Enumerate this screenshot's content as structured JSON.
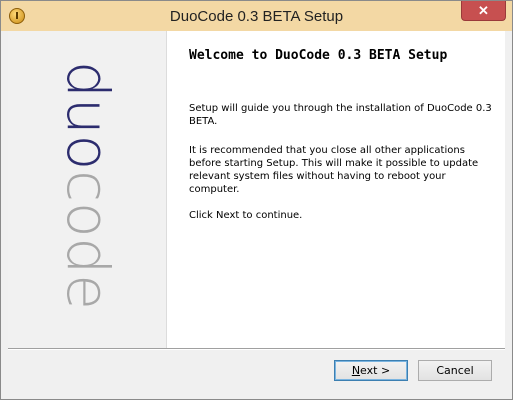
{
  "window": {
    "title": "DuoCode 0.3 BETA Setup",
    "close_symbol": "✕",
    "app_icon": "installer-icon"
  },
  "banner": {
    "logo_text_part1": "duo",
    "logo_text_part2": "code",
    "colors": {
      "duo": "#2c2c6e",
      "code": "#a8a8a8"
    }
  },
  "content": {
    "heading": "Welcome to DuoCode 0.3 BETA Setup",
    "paragraph1": "Setup will guide you through the installation of DuoCode 0.3 BETA.",
    "paragraph2": "It is recommended that you close all other applications before starting Setup. This will make it possible to update relevant system files without having to reboot your computer.",
    "paragraph3": "Click Next to continue."
  },
  "buttons": {
    "next_mnemonic": "N",
    "next_rest": "ext >",
    "cancel": "Cancel"
  }
}
